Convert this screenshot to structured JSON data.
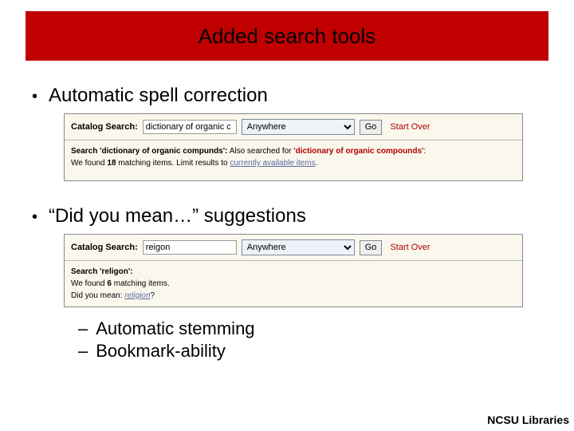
{
  "title": "Added search tools",
  "bullets": {
    "b1": "Automatic spell correction",
    "b2": "“Did you mean…” suggestions",
    "sub1": "Automatic stemming",
    "sub2": "Bookmark-ability"
  },
  "shot1": {
    "label": "Catalog Search:",
    "query": "dictionary of organic c",
    "scope": "Anywhere",
    "go": "Go",
    "start_over": "Start Over",
    "line1_a": "Search 'dictionary of organic compunds':",
    "line1_b": " Also searched for ",
    "line1_c": "'dictionary of organic compounds'",
    "line1_d": ":",
    "line2_a": "We found ",
    "line2_b": "18",
    "line2_c": " matching items. Limit results to ",
    "line2_d": "currently available items",
    "line2_e": "."
  },
  "shot2": {
    "label": "Catalog Search:",
    "query": "reigon",
    "scope": "Anywhere",
    "go": "Go",
    "start_over": "Start Over",
    "line1": "Search 'religon':",
    "line2_a": "We found ",
    "line2_b": "6",
    "line2_c": " matching items.",
    "line3_a": "Did you mean: ",
    "line3_b": "religion",
    "line3_c": "?"
  },
  "footer": "NCSU Libraries"
}
